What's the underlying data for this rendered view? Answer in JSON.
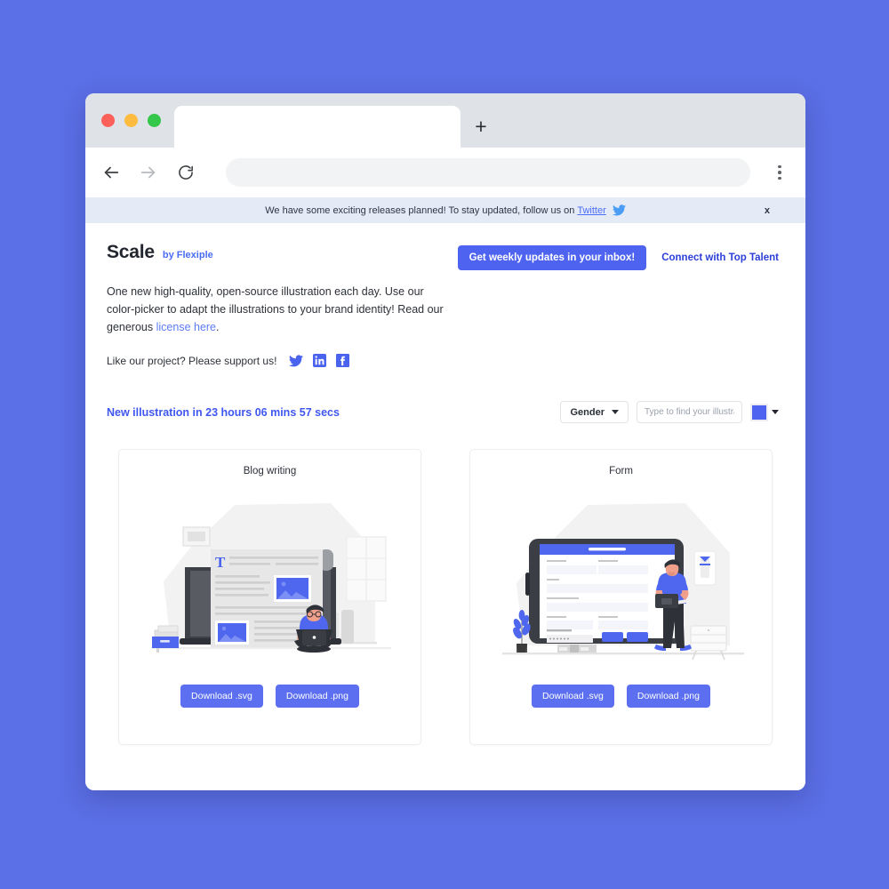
{
  "browser": {
    "tab_title": "",
    "new_tab_label": "+",
    "address_value": "",
    "back_icon": "back-arrow-icon",
    "forward_icon": "forward-arrow-icon",
    "reload_icon": "reload-icon",
    "menu_icon": "kebab-menu-icon"
  },
  "notice": {
    "text": "We have some exciting releases planned! To stay updated, follow us on",
    "link_label": "Twitter",
    "bird_icon": "twitter-bird-icon",
    "close_label": "x"
  },
  "header": {
    "brand_title": "Scale",
    "brand_by": "by Flexiple",
    "subscribe_label": "Get weekly updates in your inbox!",
    "talent_link_label": "Connect with Top Talent",
    "description_part1": "One new high-quality, open-source illustration each day. Use our color-picker to adapt the illustrations to your brand identity! Read our generous ",
    "description_link": "license here",
    "description_part2": "."
  },
  "support": {
    "text": "Like our project? Please support us!",
    "icons": [
      "twitter-icon",
      "linkedin-icon",
      "facebook-icon"
    ]
  },
  "controls": {
    "countdown_prefix": "New illustration in",
    "countdown_value": "23 hours 06 mins 57 secs",
    "gender_label": "Gender",
    "search_placeholder": "Type to find your illustrations",
    "search_value": "",
    "swatch_color": "#4e63f0"
  },
  "colors": {
    "page_background": "#5b6fe6",
    "accent": "#4e63f0",
    "link": "#4a6cf7",
    "notice_background": "#e4eaf6",
    "tabbar": "#dfe2e6"
  },
  "cards": [
    {
      "title": "Blog writing",
      "illustration": "blog-writing-illustration",
      "svg_label": "Download .svg",
      "png_label": "Download .png"
    },
    {
      "title": "Form",
      "illustration": "form-illustration",
      "svg_label": "Download .svg",
      "png_label": "Download .png"
    }
  ]
}
